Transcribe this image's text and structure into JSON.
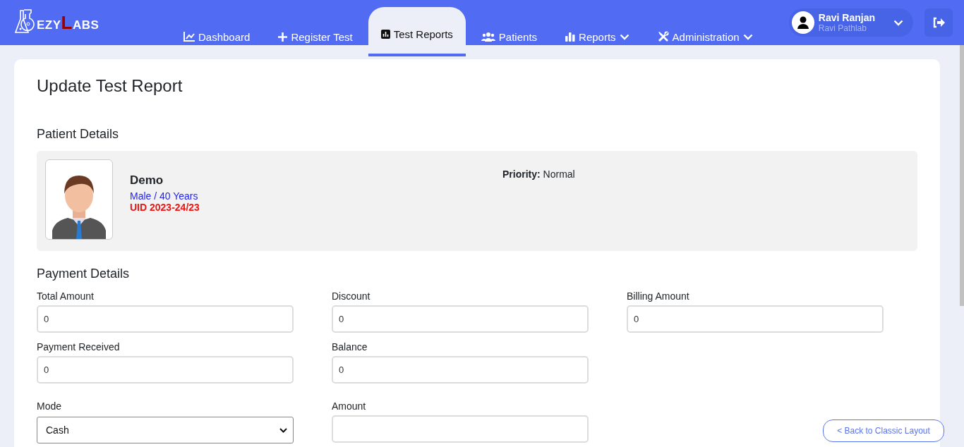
{
  "logo": [
    {
      "text": "EZY",
      "color": "#ffffff"
    },
    {
      "text": "L",
      "color": "#990000"
    },
    {
      "text": "ABS",
      "color": "#ffffff"
    }
  ],
  "nav": [
    {
      "label": "Dashboard",
      "dropdown": false,
      "selected": false
    },
    {
      "label": "Register Test",
      "dropdown": false,
      "selected": false
    },
    {
      "label": "Test Reports",
      "dropdown": false,
      "selected": true
    },
    {
      "label": "Patients",
      "dropdown": false,
      "selected": false
    },
    {
      "label": "Reports",
      "dropdown": true,
      "selected": false
    },
    {
      "label": "Administration",
      "dropdown": true,
      "selected": false
    }
  ],
  "user": {
    "name": "Ravi Ranjan",
    "lab": "Ravi Pathlab"
  },
  "page_title": "Update Test Report",
  "patient_section": "Patient Details",
  "patient": {
    "name": "Demo",
    "gender_age": "Male / 40 Years",
    "uid": "UID 2023-24/23",
    "priority_label": "Priority:",
    "priority": "Normal"
  },
  "payment_section": "Payment Details",
  "field_rows": [
    [
      {
        "label": "Total Amount",
        "value": "0",
        "kind": "input"
      },
      {
        "label": "Discount",
        "value": "0",
        "kind": "input"
      },
      {
        "label": "Billing Amount",
        "value": "0",
        "kind": "input"
      }
    ],
    [
      {
        "label": "Payment Received",
        "value": "0",
        "kind": "input"
      },
      {
        "label": "Balance",
        "value": "0",
        "kind": "input"
      }
    ],
    [
      {
        "label": "Mode",
        "value": "Cash",
        "kind": "select"
      },
      {
        "label": "Amount",
        "kind": "input"
      }
    ]
  ],
  "back_button": "< Back to Classic Layout"
}
